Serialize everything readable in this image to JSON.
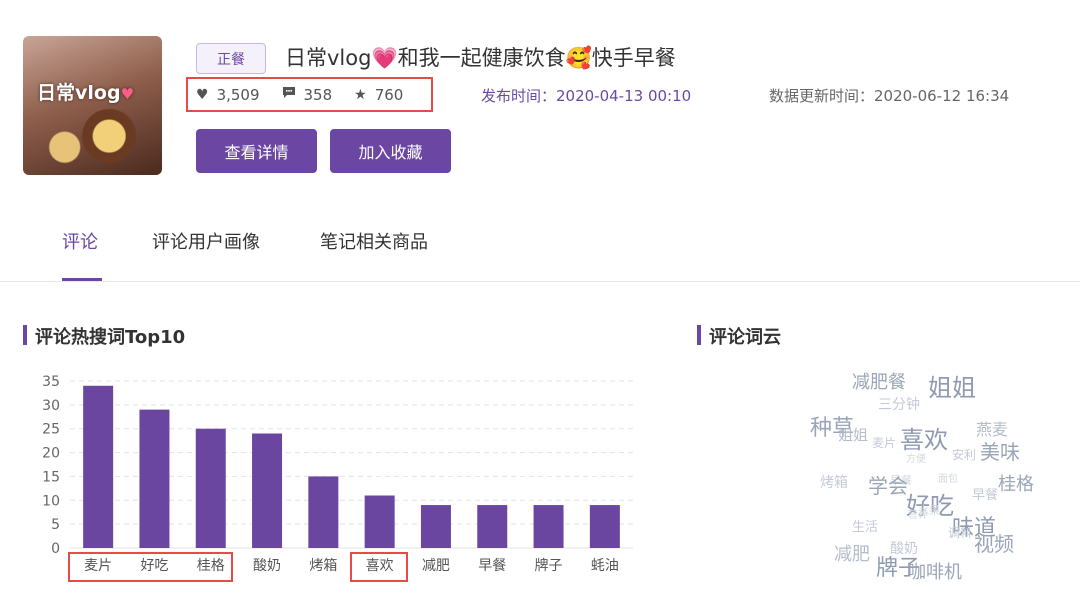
{
  "post": {
    "thumbnail_caption": "日常vlog",
    "thumbnail_heart": "♥",
    "tag": "正餐",
    "title": "日常vlog💗和我一起健康饮食🥰快手早餐",
    "likes": "3,509",
    "comments": "358",
    "favorites": "760",
    "published": "发布时间：2020-04-13 00:10",
    "updated": "数据更新时间：2020-06-12 16:34",
    "icons": {
      "likes": "heart-icon",
      "comments": "comment-icon",
      "favorites": "star-icon"
    }
  },
  "actions": {
    "detail": "查看详情",
    "collect": "加入收藏"
  },
  "tabs": [
    {
      "label": "评论",
      "active": true
    },
    {
      "label": "评论用户画像",
      "active": false
    },
    {
      "label": "笔记相关商品",
      "active": false
    }
  ],
  "sections": {
    "hot_words": "评论热搜词Top10",
    "word_cloud": "评论词云"
  },
  "colors": {
    "accent": "#6b46a3",
    "bar": "#6a46a0",
    "highlight_box": "#e84a4a"
  },
  "chart_data": {
    "type": "bar",
    "categories": [
      "麦片",
      "好吃",
      "桂格",
      "酸奶",
      "烤箱",
      "喜欢",
      "减肥",
      "早餐",
      "牌子",
      "蚝油"
    ],
    "values": [
      34,
      29,
      25,
      24,
      15,
      11,
      9,
      9,
      9,
      9
    ],
    "yticks": [
      0,
      5,
      10,
      15,
      20,
      25,
      30,
      35
    ],
    "ylim": [
      0,
      35
    ],
    "grid": "dashed horizontal",
    "highlighted_categories": [
      [
        "麦片",
        "好吃",
        "桂格"
      ],
      [
        "喜欢"
      ]
    ]
  },
  "word_cloud": [
    {
      "text": "减肥餐",
      "size": 18,
      "color": "#9aa6b8"
    },
    {
      "text": "姐姐",
      "size": 24,
      "color": "#8e9ab0"
    },
    {
      "text": "三分钟",
      "size": 14,
      "color": "#c3cad6"
    },
    {
      "text": "种草",
      "size": 22,
      "color": "#9aa6b8"
    },
    {
      "text": "姐姐",
      "size": 15,
      "color": "#b5bdca"
    },
    {
      "text": "麦片",
      "size": 12,
      "color": "#c3cad6"
    },
    {
      "text": "喜欢",
      "size": 24,
      "color": "#8e9ab0"
    },
    {
      "text": "燕麦",
      "size": 16,
      "color": "#b5bdca"
    },
    {
      "text": "美味",
      "size": 20,
      "color": "#9aa6b8"
    },
    {
      "text": "方便",
      "size": 10,
      "color": "#d3d8e0"
    },
    {
      "text": "安利",
      "size": 12,
      "color": "#c3cad6"
    },
    {
      "text": "桂格",
      "size": 18,
      "color": "#9aa6b8"
    },
    {
      "text": "烤箱",
      "size": 14,
      "color": "#c3cad6"
    },
    {
      "text": "早餐",
      "size": 11,
      "color": "#d3d8e0"
    },
    {
      "text": "学会",
      "size": 20,
      "color": "#9aa6b8"
    },
    {
      "text": "好吃",
      "size": 24,
      "color": "#8e9ab0"
    },
    {
      "text": "营养",
      "size": 10,
      "color": "#d3d8e0"
    },
    {
      "text": "面包",
      "size": 10,
      "color": "#d3d8e0"
    },
    {
      "text": "早餐",
      "size": 13,
      "color": "#c3cad6"
    },
    {
      "text": "水果",
      "size": 11,
      "color": "#d3d8e0"
    },
    {
      "text": "生活",
      "size": 13,
      "color": "#c3cad6"
    },
    {
      "text": "味道",
      "size": 22,
      "color": "#8e9ab0"
    },
    {
      "text": "调料",
      "size": 12,
      "color": "#c3cad6"
    },
    {
      "text": "视频",
      "size": 20,
      "color": "#9aa6b8"
    },
    {
      "text": "减肥",
      "size": 18,
      "color": "#b5bdca"
    },
    {
      "text": "酸奶",
      "size": 14,
      "color": "#c3cad6"
    },
    {
      "text": "牌子",
      "size": 22,
      "color": "#8e9ab0"
    },
    {
      "text": "咖啡机",
      "size": 18,
      "color": "#9aa6b8"
    }
  ]
}
